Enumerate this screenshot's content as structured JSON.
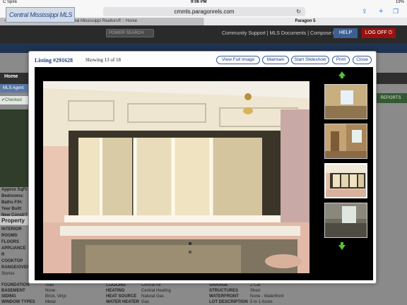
{
  "status": {
    "carrier": "C Spire",
    "time": "9:06 PM",
    "battery": "19%"
  },
  "safari": {
    "url": "cmmls.paragonrels.com"
  },
  "tabs": [
    {
      "label": "Central Mississippi Realtors® :: Home"
    },
    {
      "label": "Paragon 5"
    }
  ],
  "header": {
    "logo_text": "Central Mississippi MLS",
    "search_placeholder": "POWER SEARCH",
    "links": "Community Support | MLS Documents | Compose Email",
    "help": "HELP",
    "logoff": "LOG OFF"
  },
  "background": {
    "nav_home": "Home",
    "tab_agent": "MLS Agent",
    "checked": "Checked",
    "reports": "REPORTS",
    "summary": [
      "Approx SqFt:",
      "Bedrooms:",
      "Baths F/H:",
      "Year Built:",
      "New Constr?"
    ],
    "property_title": "Property",
    "features": [
      "INTERIOR",
      "ROOMS",
      "FLOORS",
      "APPLIANCE R",
      "COOKTOP",
      "RANGE/OVEN",
      "Stories"
    ],
    "table": [
      {
        "l1": "FOUNDATION",
        "v1": "Slab",
        "l2": "COOLING",
        "v2": "Central Air",
        "l3": "GARAGE",
        "v3": "2 Car"
      },
      {
        "l1": "BASEMENT",
        "v1": "None",
        "l2": "HEATING",
        "v2": "Central Heating",
        "l3": "STRUCTURES",
        "v3": "Shed"
      },
      {
        "l1": "SIDING",
        "v1": "Brick, Vinyl",
        "l2": "HEAT SOURCE",
        "v2": "Natural Gas",
        "l3": "WATERFRONT",
        "v3": "None - Waterfront"
      },
      {
        "l1": "WINDOW TYPES",
        "v1": "Metal",
        "l2": "WATER HEATER",
        "v2": "Gas",
        "l3": "LOT DESCRIPTION",
        "v3": "5 to 1 Acres"
      }
    ]
  },
  "modal": {
    "title": "Listing #291628",
    "count": "Showing 13 of 18",
    "buttons": {
      "full": "View Full Image",
      "maintain": "Maintain",
      "slideshow": "Start Slideshow",
      "print": "Print",
      "close": "Close"
    },
    "image_index": 13,
    "image_total": 18
  },
  "colors": {
    "accent": "#1f3c80",
    "arrow": "#55c33a",
    "logoff": "#9a1111",
    "help": "#3e5f91"
  }
}
